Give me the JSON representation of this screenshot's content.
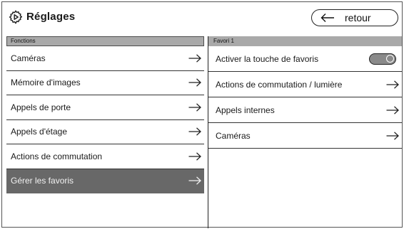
{
  "header": {
    "title": "Réglages",
    "back_label": "retour",
    "gear_icon": "gear-icon",
    "back_icon": "arrow-left-icon"
  },
  "left_panel": {
    "heading": "Fonctions",
    "items": [
      {
        "label": "Caméras",
        "active": false
      },
      {
        "label": "Mémoire d'images",
        "active": false
      },
      {
        "label": "Appels de porte",
        "active": false
      },
      {
        "label": "Appels d'étage",
        "active": false
      },
      {
        "label": "Actions de commutation",
        "active": false
      },
      {
        "label": "Gérer les favoris",
        "active": true
      }
    ]
  },
  "right_panel": {
    "heading": "Favori 1",
    "items": [
      {
        "label": "Activer la touche de favoris",
        "control": "toggle",
        "toggle_state": "off"
      },
      {
        "label": "Actions de commutation / lumière",
        "control": "arrow"
      },
      {
        "label": "Appels internes",
        "control": "arrow"
      },
      {
        "label": "Caméras",
        "control": "arrow"
      }
    ]
  },
  "colors": {
    "header_bar": "#a9a9a9",
    "active_item_bg": "#686868",
    "active_item_text": "#f1f1f1",
    "toggle_bg": "#8a8a8a"
  }
}
